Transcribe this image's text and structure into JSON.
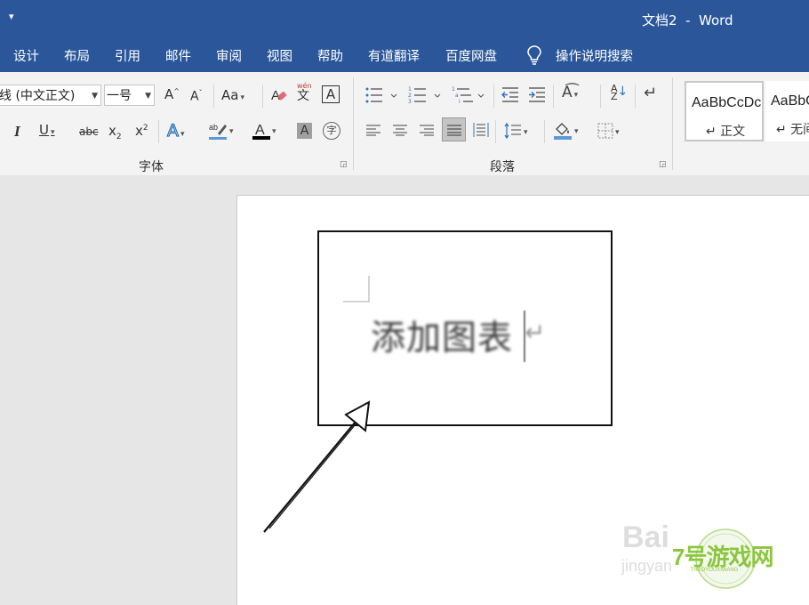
{
  "window": {
    "quick_access": "▾",
    "title": "文档2  -  Word"
  },
  "tabs": [
    "设计",
    "布局",
    "引用",
    "邮件",
    "审阅",
    "视图",
    "帮助",
    "有道翻译",
    "百度网盘"
  ],
  "tell_me": {
    "label": "操作说明搜索"
  },
  "font_group": {
    "font_name": "线 (中文正文)",
    "font_size": "一号",
    "change_case": "Aa",
    "phonetic_top": "wén",
    "phonetic_bottom": "文",
    "subscript_base": "x",
    "subscript_sub": "2",
    "superscript_base": "x",
    "superscript_sup": "2",
    "strike": "abc",
    "label": "字体"
  },
  "paragraph_group": {
    "label": "段落"
  },
  "styles": [
    {
      "sample": "AaBbCcDc",
      "name": "↵ 正文",
      "selected": true
    },
    {
      "sample": "AaBbC",
      "name": "↵ 无间",
      "selected": false
    }
  ],
  "document": {
    "body_text": "添加图表",
    "paragraph_mark": "↵"
  },
  "watermark": {
    "baidu": "Bai",
    "jingyan": "jingyan",
    "site_name": "7号游戏网",
    "site_sub": "· THAOYOUXIWANG ·"
  },
  "colors": {
    "title_bar": "#2b579a",
    "ribbon": "#f3f3f3",
    "font_color_bar": "#000000",
    "highlight_bar": "#5b9bd5"
  }
}
